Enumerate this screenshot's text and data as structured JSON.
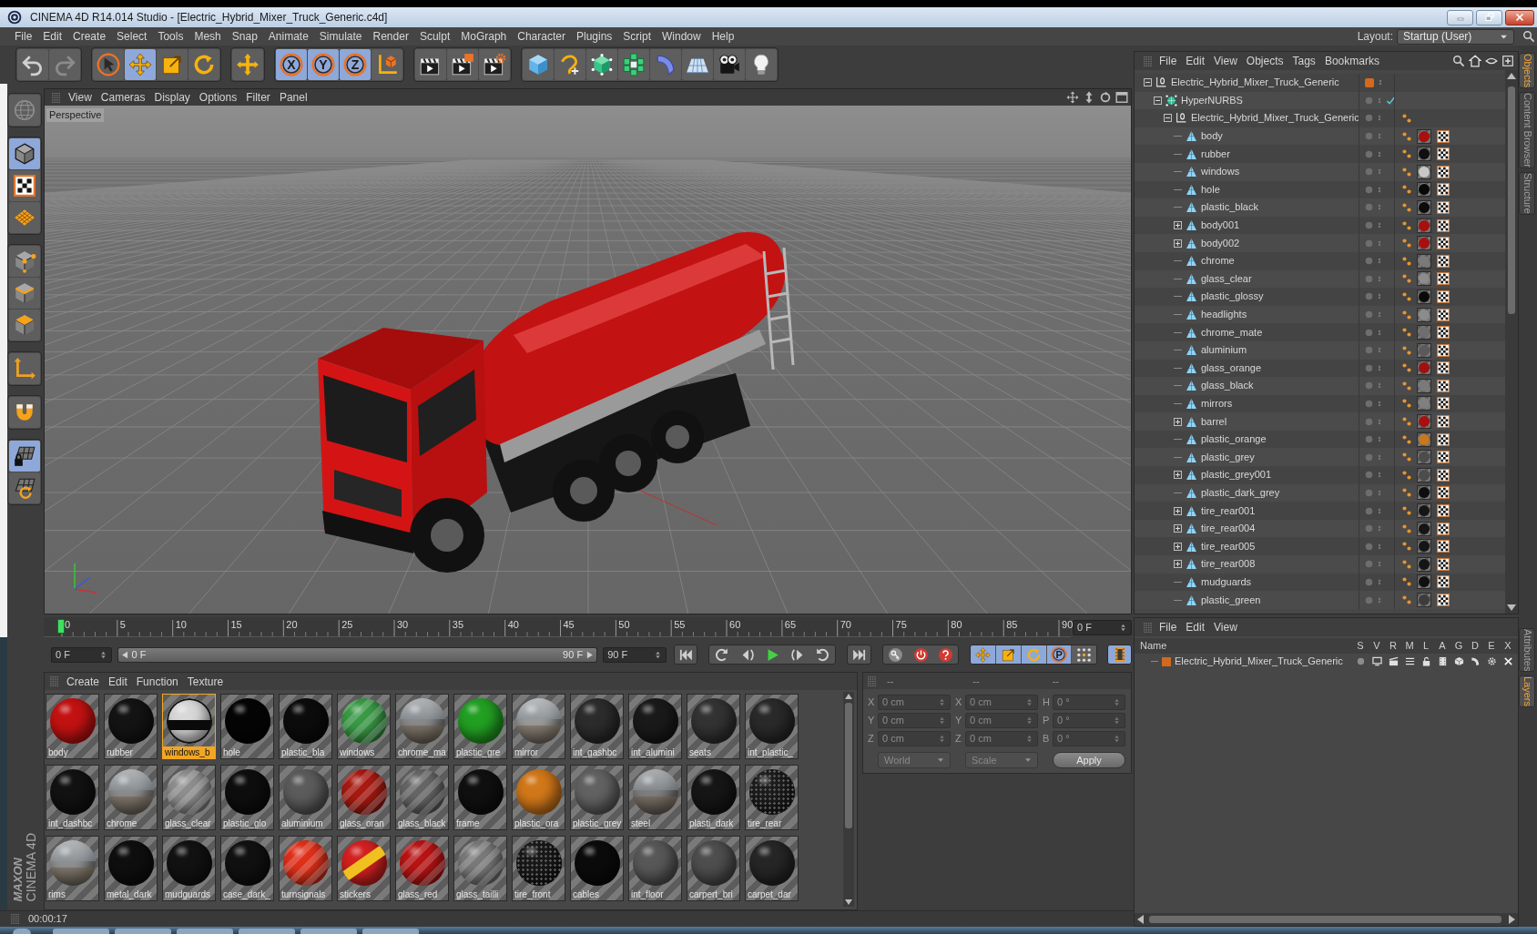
{
  "window": {
    "title": "CINEMA 4D R14.014 Studio - [Electric_Hybrid_Mixer_Truck_Generic.c4d]"
  },
  "menu": [
    "File",
    "Edit",
    "Create",
    "Select",
    "Tools",
    "Mesh",
    "Snap",
    "Animate",
    "Simulate",
    "Render",
    "Sculpt",
    "MoGraph",
    "Character",
    "Plugins",
    "Script",
    "Window",
    "Help"
  ],
  "layout": {
    "label": "Layout:",
    "value": "Startup (User)"
  },
  "toolbar": [
    {
      "tools": [
        {
          "kind": "undo",
          "selected": false,
          "disabled": false
        },
        {
          "kind": "redo",
          "selected": false,
          "disabled": true
        }
      ]
    },
    {
      "tools": [
        {
          "kind": "live-select",
          "selected": false,
          "disabled": false
        },
        {
          "kind": "move",
          "selected": true,
          "disabled": false
        },
        {
          "kind": "scale",
          "selected": false,
          "disabled": false
        },
        {
          "kind": "rotate",
          "selected": false,
          "disabled": false
        }
      ]
    },
    {
      "tools": [
        {
          "kind": "cross",
          "selected": false,
          "disabled": false
        }
      ]
    },
    {
      "tools": [
        {
          "kind": "axis-lock",
          "label": "X",
          "selected": true,
          "disabled": false
        },
        {
          "kind": "axis-lock",
          "label": "Y",
          "selected": true,
          "disabled": false
        },
        {
          "kind": "axis-lock",
          "label": "Z",
          "selected": true,
          "disabled": false
        },
        {
          "kind": "coordinate-system",
          "selected": false,
          "disabled": false
        }
      ]
    },
    {
      "tools": [
        {
          "kind": "render-view",
          "selected": false,
          "disabled": false
        },
        {
          "kind": "render-picture",
          "selected": false,
          "disabled": false
        },
        {
          "kind": "render-settings",
          "selected": false,
          "disabled": false
        }
      ]
    },
    {
      "tools": [
        {
          "kind": "cube",
          "selected": false,
          "disabled": false
        },
        {
          "kind": "spline",
          "selected": false,
          "disabled": false
        },
        {
          "kind": "subdivision",
          "selected": false,
          "disabled": false
        },
        {
          "kind": "cloner",
          "selected": false,
          "disabled": false
        },
        {
          "kind": "bend",
          "selected": false,
          "disabled": false
        },
        {
          "kind": "floor",
          "selected": false,
          "disabled": false
        },
        {
          "kind": "camera",
          "selected": false,
          "disabled": false
        },
        {
          "kind": "light",
          "selected": false,
          "disabled": false
        }
      ]
    }
  ],
  "left_toolbar": [
    {
      "tools": [
        {
          "kind": "model",
          "selected": false
        }
      ]
    },
    {
      "tools": [
        {
          "kind": "object",
          "selected": true
        },
        {
          "kind": "texture",
          "selected": false
        },
        {
          "kind": "workplane",
          "selected": false
        }
      ]
    },
    {
      "tools": [
        {
          "kind": "points",
          "selected": false
        },
        {
          "kind": "edges",
          "selected": false
        },
        {
          "kind": "polygons",
          "selected": false
        }
      ]
    },
    {
      "tools": [
        {
          "kind": "axis",
          "selected": false
        }
      ]
    },
    {
      "tools": [
        {
          "kind": "snap",
          "selected": false
        }
      ]
    },
    {
      "tools": [
        {
          "kind": "locked-workplane",
          "selected": true
        },
        {
          "kind": "workplane-refresh",
          "selected": false
        }
      ]
    }
  ],
  "logo": {
    "lines": [
      "MAXON",
      "CINEMA 4D"
    ]
  },
  "viewport": {
    "menu": [
      "View",
      "Cameras",
      "Display",
      "Options",
      "Filter",
      "Panel"
    ],
    "label": "Perspective"
  },
  "timeline": {
    "ticks": [
      "0",
      "5",
      "10",
      "15",
      "20",
      "25",
      "30",
      "35",
      "40",
      "45",
      "50",
      "55",
      "60",
      "65",
      "70",
      "75",
      "80",
      "85",
      "90"
    ],
    "playhead": {
      "level": 0
    },
    "frame": "0 F"
  },
  "transport": {
    "start": "0 F",
    "range": {
      "start": "0 F",
      "end": "90 F",
      "level": 1
    },
    "end": "90 F",
    "groups": [
      {
        "buttons": [
          {
            "kind": "first"
          }
        ]
      },
      {
        "buttons": [
          {
            "kind": "loop-back"
          },
          {
            "kind": "step-back"
          },
          {
            "kind": "play"
          },
          {
            "kind": "step-forward"
          },
          {
            "kind": "loop-forward"
          }
        ]
      },
      {
        "buttons": [
          {
            "kind": "last"
          }
        ]
      },
      {
        "buttons": [
          {
            "kind": "key"
          },
          {
            "kind": "record"
          },
          {
            "kind": "autokey"
          }
        ]
      },
      {
        "buttons": [
          {
            "kind": "move",
            "selected": true
          },
          {
            "kind": "scale",
            "selected": true
          },
          {
            "kind": "rotate",
            "selected": true
          },
          {
            "kind": "param",
            "label": "P",
            "selected": true
          },
          {
            "kind": "point-level",
            "selected": false
          }
        ]
      }
    ],
    "timeline_button": {
      "selected": true
    }
  },
  "material_manager": {
    "menu": [
      "Create",
      "Edit",
      "Function",
      "Texture"
    ],
    "materials": [
      {
        "name": "body",
        "kind": "solid",
        "color": "#c41212",
        "selected": false
      },
      {
        "name": "rubber",
        "kind": "solid",
        "color": "#141414",
        "selected": false
      },
      {
        "name": "windows_b",
        "kind": "window",
        "color": "#d8d8d8",
        "selected": true
      },
      {
        "name": "hole",
        "kind": "solid",
        "color": "#050505",
        "selected": false
      },
      {
        "name": "plastic_bla",
        "kind": "solid",
        "color": "#0c0c0c",
        "selected": false
      },
      {
        "name": "windows",
        "kind": "glass",
        "color": "#3a9a46",
        "selected": false
      },
      {
        "name": "chrome_ma",
        "kind": "chrome",
        "color": "#8a8a8a",
        "selected": false
      },
      {
        "name": "plastic_gre",
        "kind": "solid",
        "color": "#22a022",
        "selected": false
      },
      {
        "name": "mirror",
        "kind": "chrome",
        "color": "#9a9a9a",
        "selected": false
      },
      {
        "name": "int_gashbc",
        "kind": "solid",
        "color": "#2c2c2c",
        "selected": false
      },
      {
        "name": "int_alumini",
        "kind": "solid",
        "color": "#1a1a1a",
        "selected": false
      },
      {
        "name": "seats",
        "kind": "solid",
        "color": "#333333",
        "selected": false
      },
      {
        "name": "int_plastic_",
        "kind": "solid",
        "color": "#2a2a2a",
        "selected": false
      },
      {
        "name": "int_dashbc",
        "kind": "solid",
        "color": "#121212",
        "selected": false
      },
      {
        "name": "chrome",
        "kind": "chrome",
        "color": "#8c8c8c",
        "selected": false
      },
      {
        "name": "glass_clear",
        "kind": "glass",
        "color": "#8e8e8e",
        "selected": false
      },
      {
        "name": "plastic_glo",
        "kind": "solid",
        "color": "#0e0e0e",
        "selected": false
      },
      {
        "name": "aluminium",
        "kind": "solid",
        "color": "#5c5c5c",
        "selected": false
      },
      {
        "name": "glass_oran",
        "kind": "glass",
        "color": "#a81a12",
        "selected": false
      },
      {
        "name": "glass_black",
        "kind": "glass",
        "color": "#666666",
        "selected": false
      },
      {
        "name": "frame",
        "kind": "solid",
        "color": "#101010",
        "selected": false
      },
      {
        "name": "plastic_ora",
        "kind": "solid",
        "color": "#d2781a",
        "selected": false
      },
      {
        "name": "plastic_grey",
        "kind": "solid",
        "color": "#626262",
        "selected": false
      },
      {
        "name": "steel",
        "kind": "chrome",
        "color": "#7e7e7e",
        "selected": false
      },
      {
        "name": "plasti_dark",
        "kind": "solid",
        "color": "#161616",
        "selected": false
      },
      {
        "name": "tire_rear",
        "kind": "mesh",
        "color": "#1c1c1c",
        "selected": false
      },
      {
        "name": "rims",
        "kind": "chrome",
        "color": "#909090",
        "selected": false
      },
      {
        "name": "metal_dark",
        "kind": "solid",
        "color": "#0f0f0f",
        "selected": false
      },
      {
        "name": "mudguards",
        "kind": "solid",
        "color": "#121212",
        "selected": false
      },
      {
        "name": "case_dark_",
        "kind": "solid",
        "color": "#111111",
        "selected": false
      },
      {
        "name": "turnsignals",
        "kind": "glass",
        "color": "#e0301a",
        "selected": false
      },
      {
        "name": "stickers",
        "kind": "sticker",
        "color": "#d42020",
        "selected": false
      },
      {
        "name": "glass_red",
        "kind": "glass",
        "color": "#b81414",
        "selected": false
      },
      {
        "name": "glass_tailli",
        "kind": "glass",
        "color": "#7a7a7a",
        "selected": false
      },
      {
        "name": "tire_front",
        "kind": "mesh",
        "color": "#181818",
        "selected": false
      },
      {
        "name": "cables",
        "kind": "solid",
        "color": "#0b0b0b",
        "selected": false
      },
      {
        "name": "int_floor",
        "kind": "solid",
        "color": "#585858",
        "selected": false
      },
      {
        "name": "carpert_bri",
        "kind": "solid",
        "color": "#4e4e4e",
        "selected": false
      },
      {
        "name": "carpet_dar",
        "kind": "solid",
        "color": "#262626",
        "selected": false
      }
    ]
  },
  "coordinates": {
    "headers": [
      "--",
      "--",
      "--"
    ],
    "columns": [
      [
        {
          "label": "X",
          "value": "0 cm"
        },
        {
          "label": "Y",
          "value": "0 cm"
        },
        {
          "label": "Z",
          "value": "0 cm"
        }
      ],
      [
        {
          "label": "X",
          "value": "0 cm"
        },
        {
          "label": "Y",
          "value": "0 cm"
        },
        {
          "label": "Z",
          "value": "0 cm"
        }
      ],
      [
        {
          "label": "H",
          "value": "0 °"
        },
        {
          "label": "P",
          "value": "0 °"
        },
        {
          "label": "B",
          "value": "0 °"
        }
      ]
    ],
    "space": "World",
    "mode": "Scale",
    "apply": "Apply"
  },
  "status_bar": {
    "time": "00:00:17"
  },
  "object_manager": {
    "menu": [
      "File",
      "Edit",
      "View",
      "Objects",
      "Tags",
      "Bookmarks"
    ],
    "tree": [
      {
        "name": "Electric_Hybrid_Mixer_Truck_Generic",
        "kind": "null",
        "expanded": true,
        "color": "#d2691e",
        "children": [
          {
            "name": "HyperNURBS",
            "kind": "hypernurbs",
            "expanded": true,
            "enabled": true,
            "children": [
              {
                "name": "Electric_Hybrid_Mixer_Truck_Generic",
                "kind": "null",
                "expanded": true,
                "tags": [
                  {
                    "kind": "phong"
                  }
                ],
                "children": [
                  {
                    "name": "body",
                    "kind": "polygon",
                    "tags": [
                      {
                        "kind": "phong"
                      },
                      {
                        "kind": "material",
                        "color": "#a80f0f"
                      },
                      {
                        "kind": "uvw"
                      }
                    ]
                  },
                  {
                    "name": "rubber",
                    "kind": "polygon",
                    "tags": [
                      {
                        "kind": "phong"
                      },
                      {
                        "kind": "material",
                        "color": "#101010"
                      },
                      {
                        "kind": "uvw"
                      }
                    ]
                  },
                  {
                    "name": "windows",
                    "kind": "polygon",
                    "tags": [
                      {
                        "kind": "phong"
                      },
                      {
                        "kind": "material",
                        "color": "#c8c8c8"
                      },
                      {
                        "kind": "uvw"
                      }
                    ]
                  },
                  {
                    "name": "hole",
                    "kind": "polygon",
                    "tags": [
                      {
                        "kind": "phong"
                      },
                      {
                        "kind": "material",
                        "color": "#080808"
                      },
                      {
                        "kind": "uvw"
                      }
                    ]
                  },
                  {
                    "name": "plastic_black",
                    "kind": "polygon",
                    "tags": [
                      {
                        "kind": "phong"
                      },
                      {
                        "kind": "material",
                        "color": "#0c0c0c"
                      },
                      {
                        "kind": "uvw"
                      }
                    ]
                  },
                  {
                    "name": "body001",
                    "kind": "polygon",
                    "expanded": false,
                    "tags": [
                      {
                        "kind": "phong"
                      },
                      {
                        "kind": "material",
                        "color": "#a80f0f"
                      },
                      {
                        "kind": "uvw"
                      }
                    ]
                  },
                  {
                    "name": "body002",
                    "kind": "polygon",
                    "expanded": false,
                    "tags": [
                      {
                        "kind": "phong"
                      },
                      {
                        "kind": "material",
                        "color": "#a80f0f"
                      },
                      {
                        "kind": "uvw"
                      }
                    ]
                  },
                  {
                    "name": "chrome",
                    "kind": "polygon",
                    "tags": [
                      {
                        "kind": "phong"
                      },
                      {
                        "kind": "material",
                        "color": "#7a7a7a"
                      },
                      {
                        "kind": "uvw"
                      }
                    ]
                  },
                  {
                    "name": "glass_clear",
                    "kind": "polygon",
                    "tags": [
                      {
                        "kind": "phong"
                      },
                      {
                        "kind": "material",
                        "color": "#8c8c8c"
                      },
                      {
                        "kind": "uvw"
                      }
                    ]
                  },
                  {
                    "name": "plastic_glossy",
                    "kind": "polygon",
                    "tags": [
                      {
                        "kind": "phong"
                      },
                      {
                        "kind": "material",
                        "color": "#0a0a0a"
                      },
                      {
                        "kind": "uvw"
                      }
                    ]
                  },
                  {
                    "name": "headlights",
                    "kind": "polygon",
                    "tags": [
                      {
                        "kind": "phong"
                      },
                      {
                        "kind": "material",
                        "color": "#8c8c8c"
                      },
                      {
                        "kind": "uvw"
                      }
                    ]
                  },
                  {
                    "name": "chrome_mate",
                    "kind": "polygon",
                    "tags": [
                      {
                        "kind": "phong"
                      },
                      {
                        "kind": "material",
                        "color": "#6e6e6e"
                      },
                      {
                        "kind": "uvw"
                      }
                    ]
                  },
                  {
                    "name": "aluminium",
                    "kind": "polygon",
                    "tags": [
                      {
                        "kind": "phong"
                      },
                      {
                        "kind": "material",
                        "color": "#5a5a5a"
                      },
                      {
                        "kind": "uvw"
                      }
                    ]
                  },
                  {
                    "name": "glass_orange",
                    "kind": "polygon",
                    "tags": [
                      {
                        "kind": "phong"
                      },
                      {
                        "kind": "material",
                        "color": "#a01010"
                      },
                      {
                        "kind": "uvw"
                      }
                    ]
                  },
                  {
                    "name": "glass_black",
                    "kind": "polygon",
                    "tags": [
                      {
                        "kind": "phong"
                      },
                      {
                        "kind": "material",
                        "color": "#7a7a7a"
                      },
                      {
                        "kind": "uvw"
                      }
                    ]
                  },
                  {
                    "name": "mirrors",
                    "kind": "polygon",
                    "tags": [
                      {
                        "kind": "phong"
                      },
                      {
                        "kind": "material",
                        "color": "#808080"
                      },
                      {
                        "kind": "uvw"
                      }
                    ]
                  },
                  {
                    "name": "barrel",
                    "kind": "polygon",
                    "expanded": false,
                    "tags": [
                      {
                        "kind": "phong"
                      },
                      {
                        "kind": "material",
                        "color": "#a80f0f"
                      },
                      {
                        "kind": "uvw"
                      }
                    ]
                  },
                  {
                    "name": "plastic_orange",
                    "kind": "polygon",
                    "tags": [
                      {
                        "kind": "phong"
                      },
                      {
                        "kind": "material",
                        "color": "#c8781e"
                      },
                      {
                        "kind": "uvw"
                      }
                    ]
                  },
                  {
                    "name": "plastic_grey",
                    "kind": "polygon",
                    "tags": [
                      {
                        "kind": "phong"
                      },
                      {
                        "kind": "material",
                        "color": "#4c4c4c"
                      },
                      {
                        "kind": "uvw"
                      }
                    ]
                  },
                  {
                    "name": "plastic_grey001",
                    "kind": "polygon",
                    "expanded": false,
                    "tags": [
                      {
                        "kind": "phong"
                      },
                      {
                        "kind": "material",
                        "color": "#4c4c4c"
                      },
                      {
                        "kind": "uvw"
                      }
                    ]
                  },
                  {
                    "name": "plastic_dark_grey",
                    "kind": "polygon",
                    "tags": [
                      {
                        "kind": "phong"
                      },
                      {
                        "kind": "material",
                        "color": "#0e0e0e"
                      },
                      {
                        "kind": "uvw"
                      }
                    ]
                  },
                  {
                    "name": "tire_rear001",
                    "kind": "polygon",
                    "expanded": false,
                    "tags": [
                      {
                        "kind": "phong"
                      },
                      {
                        "kind": "material",
                        "color": "#151515"
                      },
                      {
                        "kind": "uvw"
                      }
                    ]
                  },
                  {
                    "name": "tire_rear004",
                    "kind": "polygon",
                    "expanded": false,
                    "tags": [
                      {
                        "kind": "phong"
                      },
                      {
                        "kind": "material",
                        "color": "#151515"
                      },
                      {
                        "kind": "uvw"
                      }
                    ]
                  },
                  {
                    "name": "tire_rear005",
                    "kind": "polygon",
                    "expanded": false,
                    "tags": [
                      {
                        "kind": "phong"
                      },
                      {
                        "kind": "material",
                        "color": "#151515"
                      },
                      {
                        "kind": "uvw"
                      }
                    ]
                  },
                  {
                    "name": "tire_rear008",
                    "kind": "polygon",
                    "expanded": false,
                    "tags": [
                      {
                        "kind": "phong"
                      },
                      {
                        "kind": "material",
                        "color": "#151515"
                      },
                      {
                        "kind": "uvw"
                      }
                    ]
                  },
                  {
                    "name": "mudguards",
                    "kind": "polygon",
                    "tags": [
                      {
                        "kind": "phong"
                      },
                      {
                        "kind": "material",
                        "color": "#101010"
                      },
                      {
                        "kind": "uvw"
                      }
                    ]
                  },
                  {
                    "name": "plastic_green",
                    "kind": "polygon",
                    "tags": [
                      {
                        "kind": "phong"
                      },
                      {
                        "kind": "material",
                        "color": "#3c3c3c"
                      },
                      {
                        "kind": "uvw"
                      }
                    ]
                  }
                ]
              }
            ]
          }
        ]
      }
    ]
  },
  "layer_manager": {
    "menu": [
      "File",
      "Edit",
      "View"
    ],
    "columns": [
      "Name",
      "S",
      "V",
      "R",
      "M",
      "L",
      "A",
      "G",
      "D",
      "E",
      "X"
    ],
    "layers": [
      {
        "name": "Electric_Hybrid_Mixer_Truck_Generic",
        "color": "#d2691e"
      }
    ]
  },
  "side_tabs": {
    "upper": [
      {
        "label": "Objects",
        "selected": true
      },
      {
        "label": "Content Browser",
        "selected": false
      },
      {
        "label": "Structure",
        "selected": false
      }
    ],
    "lower": [
      {
        "label": "Attributes",
        "selected": false
      },
      {
        "label": "Layers",
        "selected": true
      }
    ]
  }
}
